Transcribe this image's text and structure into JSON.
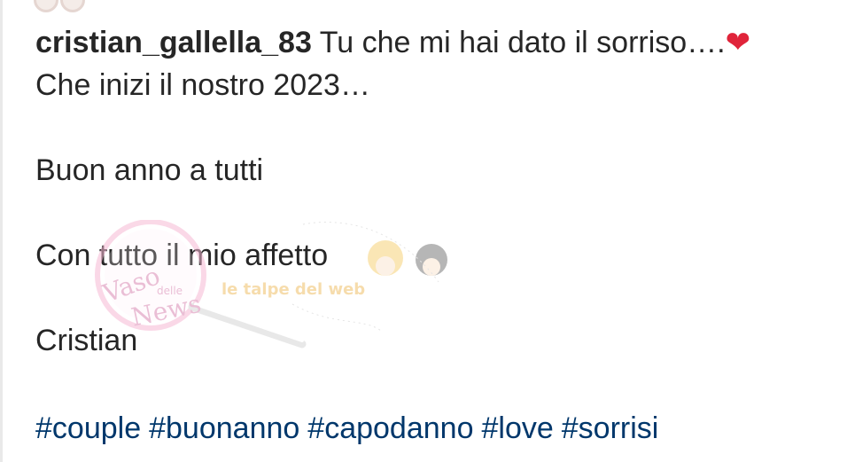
{
  "post": {
    "username": "cristian_gallella_83",
    "caption_first": "Tu che mi hai dato il sorriso….",
    "heart_icon": "red-heart",
    "line2": "Che inizi il nostro 2023…",
    "line3": "Buon anno a tutti",
    "line4": "Con tutto il mio affetto",
    "line5": "Cristian",
    "hashtags": [
      "#couple",
      "#buonanno",
      "#capodanno",
      "#love",
      "#sorrisi"
    ]
  },
  "watermark": {
    "text1": "Vaso delle News",
    "text2": "le talpe del web"
  },
  "colors": {
    "text": "#262626",
    "hashtag": "#00376b",
    "heart": "#e0243a"
  }
}
